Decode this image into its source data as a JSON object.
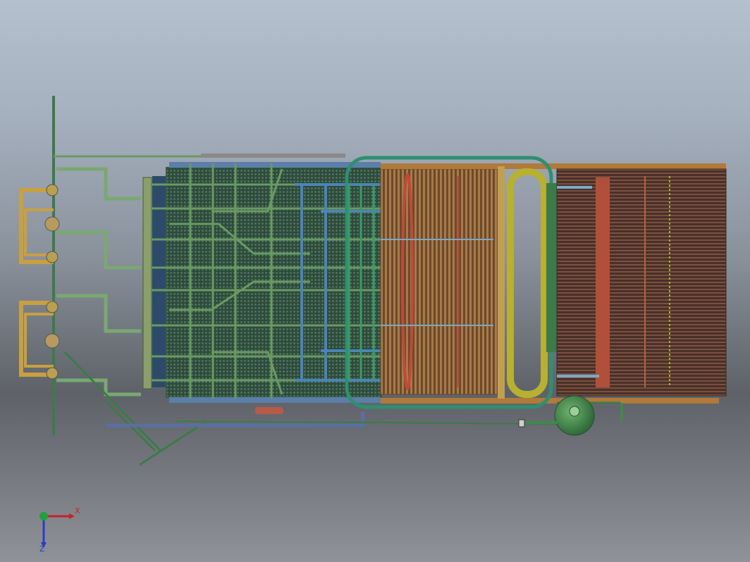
{
  "viewport": {
    "scene": "cad-assembly-top-view"
  },
  "triad": {
    "x_label": "X",
    "z_label": "Z",
    "x_color": "#c8202a",
    "y_color": "#20a040",
    "z_color": "#2a3cc8"
  },
  "colors": {
    "pipe_green": "#6a9a62",
    "pipe_dark_green": "#3d7a4a",
    "teal_loop": "#2f8f6f",
    "header_blue": "#5a7fa8",
    "tube_orange": "#b07a3a",
    "rust_red": "#b84a3a",
    "yellow_header": "#b8b030",
    "gold_loop": "#c9a040",
    "fan_green": "#3f8a4a"
  }
}
